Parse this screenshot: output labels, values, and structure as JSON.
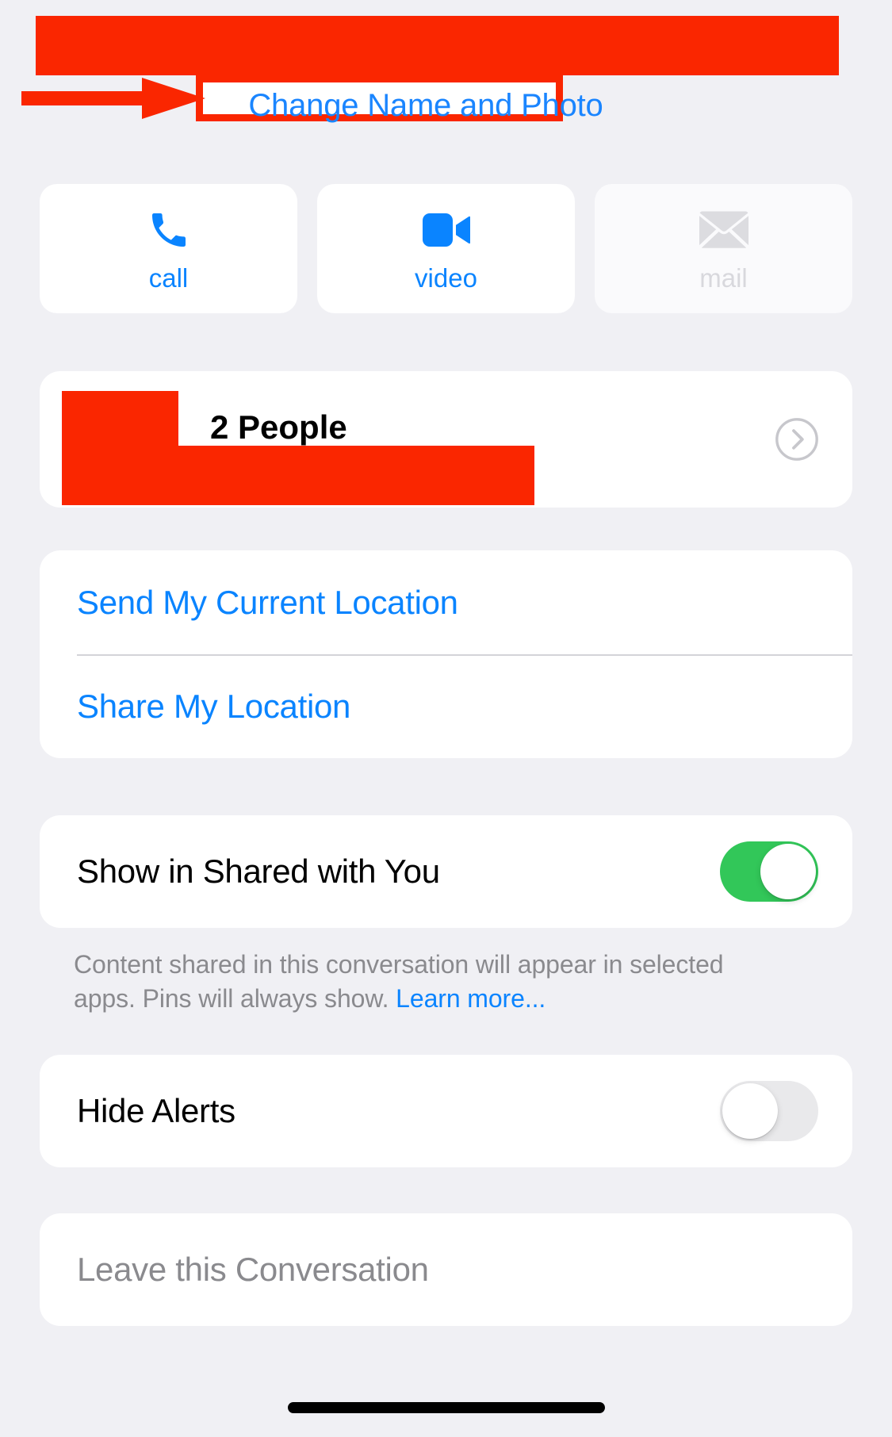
{
  "screen": {
    "name": "messages-conversation-details",
    "background_color": "#f0f0f4",
    "accent_color": "#0a84ff",
    "annotation_color": "#fa2600",
    "toggle_on_color": "#32c759"
  },
  "header": {
    "redacted_name_banner": "",
    "change_name_and_photo_label": "Change Name and Photo"
  },
  "annotation": {
    "arrow": "right-arrow",
    "highlight_target": "Change Name and Photo"
  },
  "actions": [
    {
      "key": "call",
      "label": "call",
      "icon": "phone-icon",
      "enabled": true,
      "color": "#0a84ff"
    },
    {
      "key": "video",
      "label": "video",
      "icon": "video-icon",
      "enabled": true,
      "color": "#0a84ff"
    },
    {
      "key": "mail",
      "label": "mail",
      "icon": "envelope-icon",
      "enabled": false,
      "color": "#d8d8dd"
    }
  ],
  "people": {
    "label": "2 People",
    "chevron": "chevron-right-circle-icon"
  },
  "location": {
    "send_current": "Send My Current Location",
    "share": "Share My Location"
  },
  "shared_with_you": {
    "label": "Show in Shared with You",
    "toggle_state": "on",
    "footnote_text": "Content shared in this conversation will appear in selected apps. Pins will always show. ",
    "footnote_link": "Learn more..."
  },
  "hide_alerts": {
    "label": "Hide Alerts",
    "toggle_state": "off"
  },
  "leave": {
    "label": "Leave this Conversation",
    "enabled": false
  }
}
